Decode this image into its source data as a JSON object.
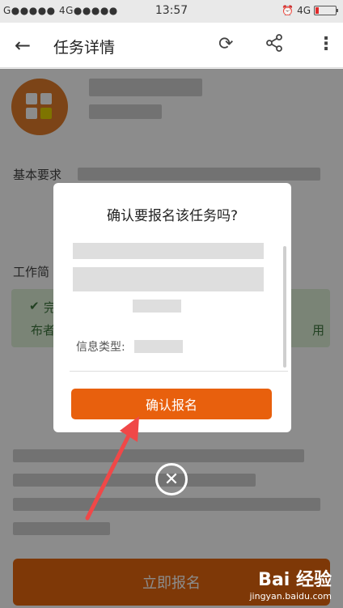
{
  "status_bar": {
    "carrier": "G●●●●● 4G●●●●●",
    "time": "13:57",
    "network": "4G"
  },
  "header": {
    "title": "任务详情"
  },
  "page": {
    "basic_requirements_label": "基本要求",
    "work_intro_label": "工作简",
    "green_left_top": "完",
    "green_left_bottom": "布者",
    "green_right": "用",
    "signup_button": "立即报名"
  },
  "dialog": {
    "title": "确认要报名该任务吗?",
    "info_type_label": "信息类型:",
    "confirm_button": "确认报名"
  },
  "watermark": {
    "brand": "Bai 经验",
    "url": "jingyan.baidu.com"
  },
  "colors": {
    "accent": "#e8600d",
    "avatar": "#e27d2a",
    "green_bg": "#dff0d8"
  }
}
